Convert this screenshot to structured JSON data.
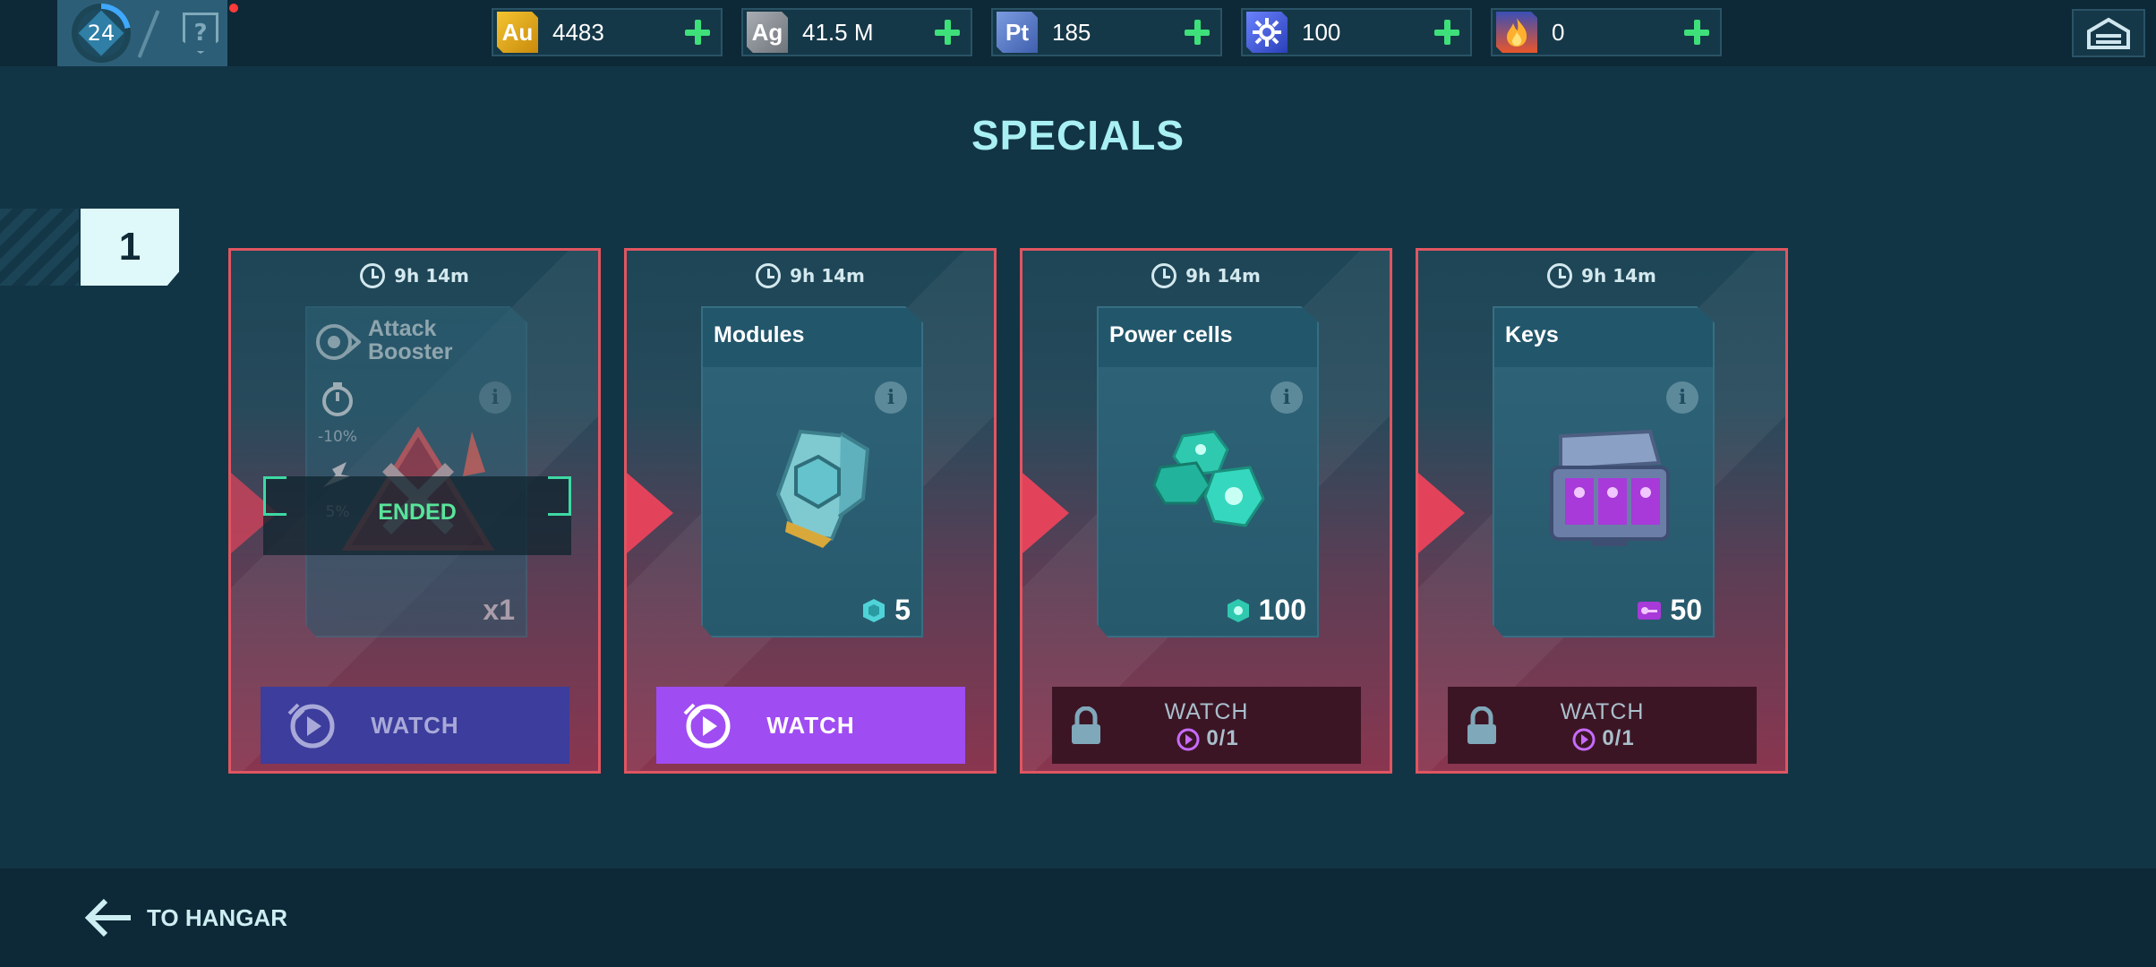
{
  "player": {
    "level": "24",
    "help_symbol": "?"
  },
  "currencies": [
    {
      "symbol": "Au",
      "value": "4483",
      "color": "#e1a619"
    },
    {
      "symbol": "Ag",
      "value": "41.5 M",
      "color": "#8b8f95"
    },
    {
      "symbol": "Pt",
      "value": "185",
      "color": "#5d7fc7"
    },
    {
      "symbol": "",
      "icon": "token-gear-icon",
      "value": "100",
      "color": "#3b54d4"
    },
    {
      "symbol": "",
      "icon": "fire-icon",
      "value": "0",
      "color": "#e8562a"
    }
  ],
  "title": "SPECIALS",
  "page_number": "1",
  "cards": [
    {
      "timer": "9h 14m",
      "name_line1": "Attack",
      "name_line2": "Booster",
      "stat1": "-10%",
      "stat2": "5%",
      "status": "ENDED",
      "quantity": "x1",
      "button": "WATCH",
      "state": "ended"
    },
    {
      "timer": "9h 14m",
      "name": "Modules",
      "quantity": "5",
      "button": "WATCH",
      "state": "active"
    },
    {
      "timer": "9h 14m",
      "name": "Power cells",
      "quantity": "100",
      "button": "WATCH",
      "watch_count": "0/1",
      "state": "locked"
    },
    {
      "timer": "9h 14m",
      "name": "Keys",
      "quantity": "50",
      "button": "WATCH",
      "watch_count": "0/1",
      "state": "locked"
    }
  ],
  "footer": {
    "back_label": "TO HANGAR"
  },
  "colors": {
    "accent_cyan": "#a9f0f2",
    "card_border": "#e05561",
    "watch_active": "#9f4cf3",
    "ended_green": "#58e49a"
  }
}
